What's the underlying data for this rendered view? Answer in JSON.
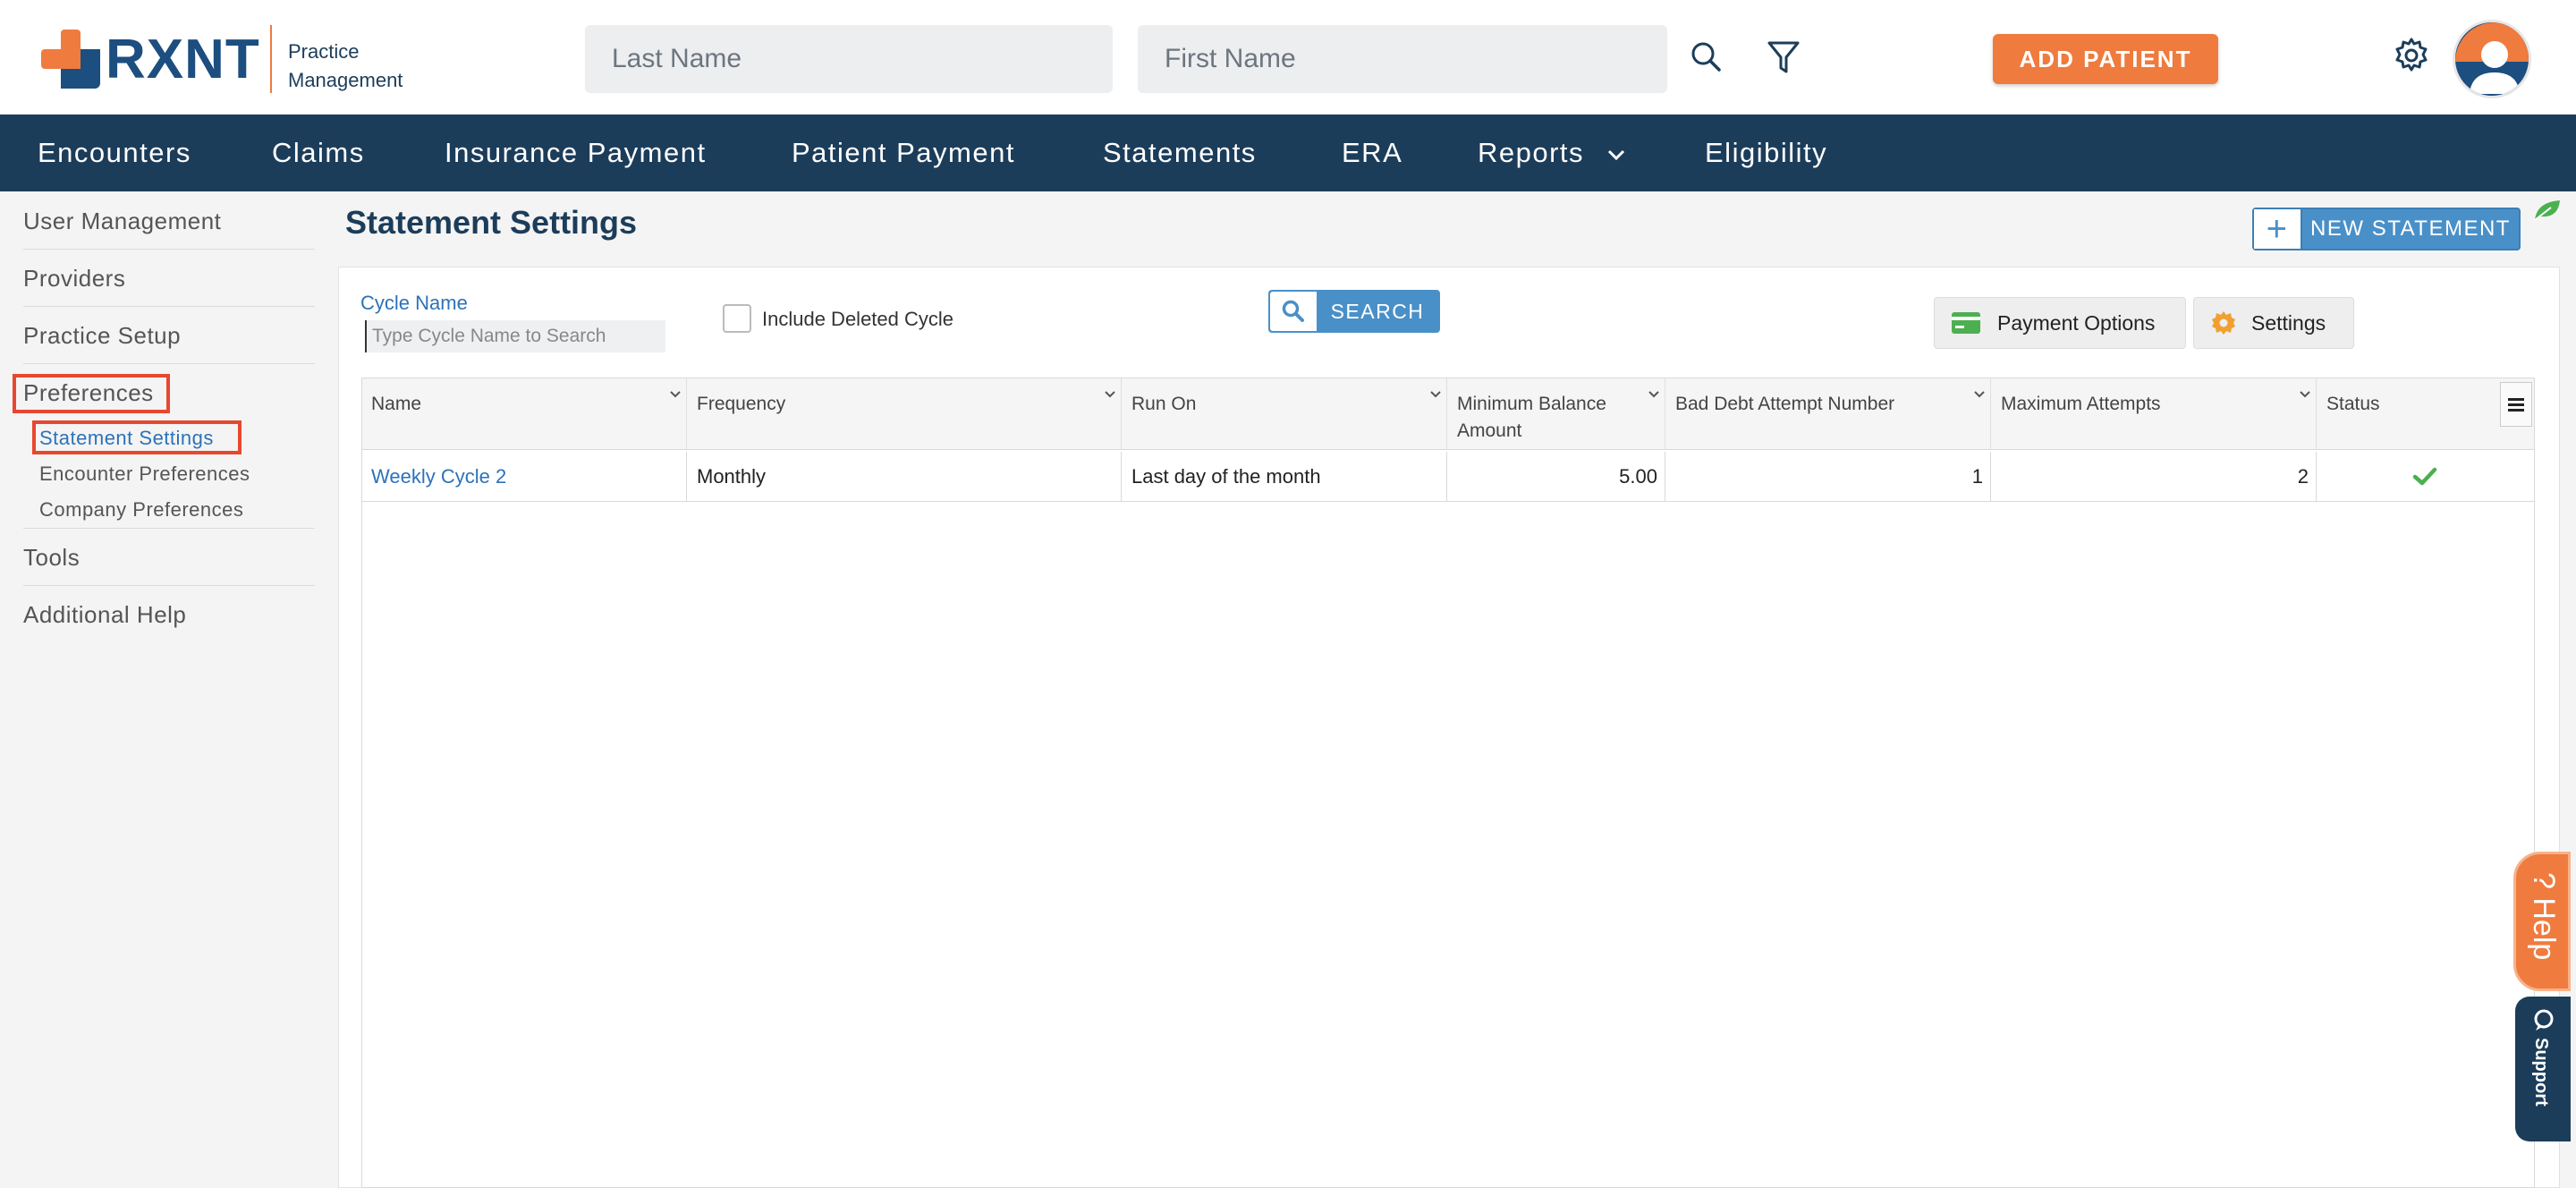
{
  "header": {
    "logo_text": "RXNT",
    "logo_sub_line1": "Practice",
    "logo_sub_line2": "Management",
    "last_name_placeholder": "Last Name",
    "first_name_placeholder": "First Name",
    "add_patient_label": "ADD PATIENT"
  },
  "nav": {
    "items": [
      "Encounters",
      "Claims",
      "Insurance Payment",
      "Patient Payment",
      "Statements",
      "ERA",
      "Reports",
      "Eligibility"
    ]
  },
  "sidebar": {
    "items": [
      "User Management",
      "Providers",
      "Practice Setup",
      "Preferences",
      "Tools",
      "Additional Help"
    ],
    "sub_items": [
      "Statement Settings",
      "Encounter Preferences",
      "Company Preferences"
    ]
  },
  "page": {
    "title": "Statement Settings",
    "new_statement_label": "NEW STATEMENT"
  },
  "filters": {
    "cycle_name_label": "Cycle Name",
    "cycle_name_placeholder": "Type Cycle Name to Search",
    "include_deleted_label": "Include Deleted Cycle",
    "search_label": "SEARCH",
    "payment_options_label": "Payment Options",
    "settings_label": "Settings"
  },
  "table": {
    "columns": [
      "Name",
      "Frequency",
      "Run On",
      "Minimum Balance Amount",
      "Bad Debt Attempt Number",
      "Maximum Attempts",
      "Status"
    ],
    "min_balance_line1": "Minimum Balance",
    "min_balance_line2": "Amount",
    "rows": [
      {
        "name": "Weekly Cycle 2",
        "frequency": "Monthly",
        "run_on": "Last day of the month",
        "min_balance": "5.00",
        "bad_debt_attempt": "1",
        "max_attempts": "2",
        "status": "active"
      }
    ]
  },
  "floating": {
    "help_label": "? Help",
    "support_label": "Support"
  },
  "colors": {
    "brand_navy": "#1c3d5a",
    "brand_orange": "#ef7b3e",
    "accent_blue": "#4a90c8",
    "highlight_red": "#e8472f",
    "status_green": "#4caf50"
  }
}
